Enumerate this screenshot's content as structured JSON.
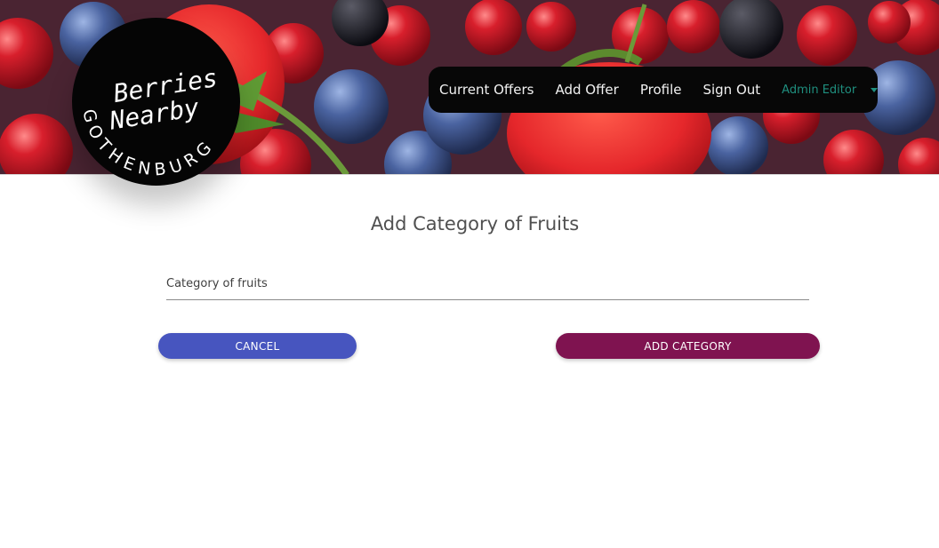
{
  "header": {
    "logo": {
      "line1": "Berries",
      "line2": "Nearby",
      "circle_text": "GOTHENBURG"
    },
    "nav": {
      "links": [
        "Current Offers",
        "Add Offer",
        "Profile",
        "Sign Out"
      ],
      "user_label": "Admin Editor",
      "caret_icon": "caret-down-icon"
    }
  },
  "main": {
    "title": "Add Category of Fruits",
    "category_field": {
      "placeholder": "Category of fruits",
      "value": ""
    },
    "cancel_label": "CANCEL",
    "add_label": "ADD CATEGORY"
  },
  "colors": {
    "nav_background": "#070707",
    "nav_user": "#1f8f7f",
    "cancel_button": "#4755bf",
    "add_button": "#7f1350"
  }
}
